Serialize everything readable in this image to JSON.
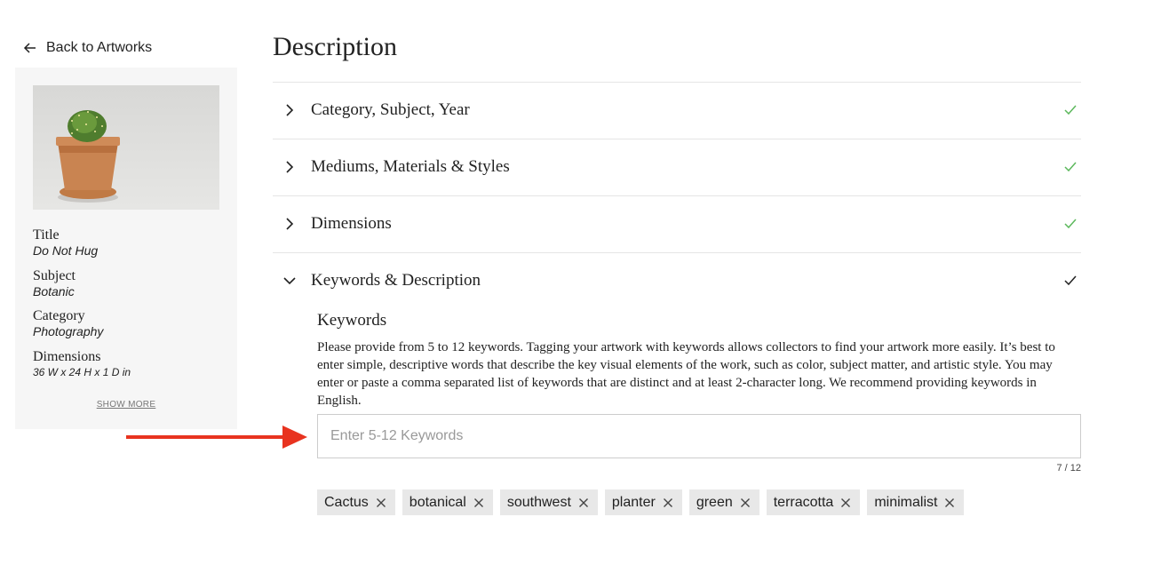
{
  "nav": {
    "back_label": "Back to Artworks"
  },
  "artwork": {
    "fields": [
      {
        "label": "Title",
        "value": "Do Not Hug"
      },
      {
        "label": "Subject",
        "value": "Botanic"
      },
      {
        "label": "Category",
        "value": "Photography"
      },
      {
        "label": "Dimensions",
        "value": "36 W x 24 H x 1 D in"
      }
    ],
    "show_more_label": "SHOW MORE"
  },
  "page": {
    "title": "Description"
  },
  "sections": [
    {
      "label": "Category, Subject, Year",
      "complete": true,
      "expanded": false
    },
    {
      "label": "Mediums, Materials & Styles",
      "complete": true,
      "expanded": false
    },
    {
      "label": "Dimensions",
      "complete": true,
      "expanded": false
    },
    {
      "label": "Keywords & Description",
      "complete": true,
      "expanded": true
    }
  ],
  "keywords": {
    "title": "Keywords",
    "description": "Please provide from 5 to 12 keywords. Tagging your artwork with keywords allows collectors to find your artwork more easily. It’s best to enter simple, descriptive words that describe the key visual elements of the work, such as color, subject matter, and artistic style. You may enter or paste a comma separated list of keywords that are distinct and at least 2-character long. We recommend providing keywords in English.",
    "input_placeholder": "Enter 5-12 Keywords",
    "input_value": "",
    "counter": "7 / 12",
    "tags": [
      "Cactus",
      "botanical",
      "southwest",
      "planter",
      "green",
      "terracotta",
      "minimalist"
    ]
  },
  "colors": {
    "check_complete": "#5cb85c",
    "check_active": "#222222",
    "annotation_arrow": "#e8331f",
    "card_background": "#f6f6f6",
    "tag_background": "#e8e8e8"
  },
  "icons": {
    "back": "arrow-left-icon",
    "collapsed": "chevron-right-icon",
    "expanded": "chevron-down-icon",
    "complete": "check-icon",
    "remove_tag": "close-icon"
  }
}
